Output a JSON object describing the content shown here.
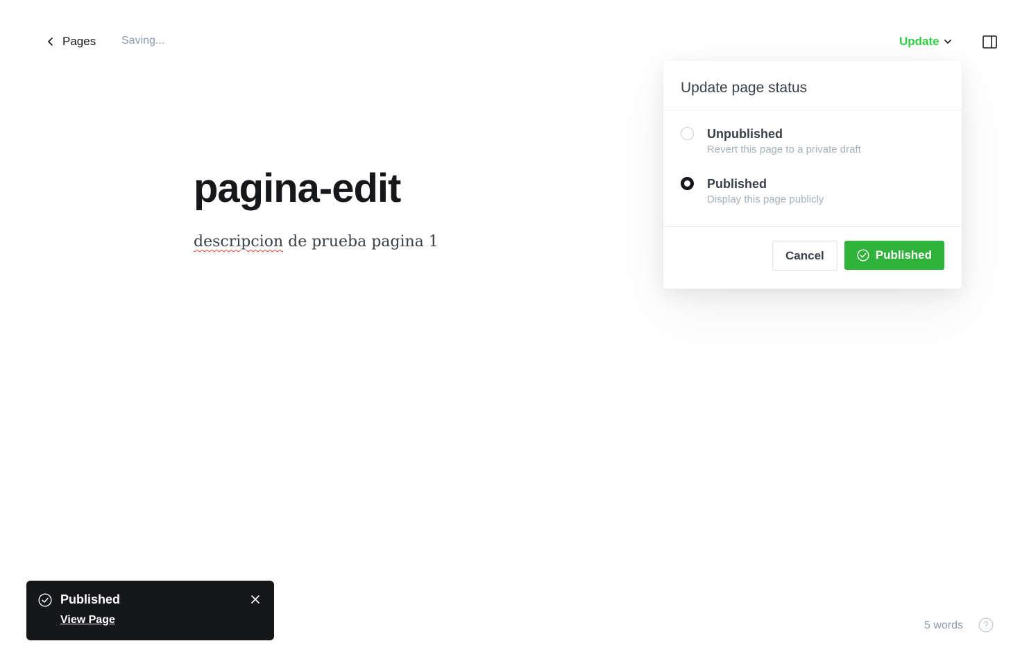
{
  "header": {
    "back_label": "Pages",
    "saving_status": "Saving...",
    "update_label": "Update"
  },
  "editor": {
    "title": "pagina-edit",
    "body_misspelled": "descripcion",
    "body_rest": " de prueba pagina 1"
  },
  "status_popover": {
    "title": "Update page status",
    "options": [
      {
        "label": "Unpublished",
        "description": "Revert this page to a private draft",
        "selected": false
      },
      {
        "label": "Published",
        "description": "Display this page publicly",
        "selected": true
      }
    ],
    "cancel_label": "Cancel",
    "confirm_label": "Published"
  },
  "toast": {
    "title": "Published",
    "link_label": "View Page"
  },
  "footer": {
    "word_count": "5 words"
  },
  "colors": {
    "accent_green": "#30cf43",
    "button_green": "#30b33a",
    "toast_bg": "#15171a"
  },
  "icons": {
    "back": "chevron-left-icon",
    "update": "chevron-down-icon",
    "sidebar": "sidebar-toggle-icon",
    "confirm": "check-circle-icon",
    "close": "close-icon",
    "help": "help-circle-icon"
  }
}
